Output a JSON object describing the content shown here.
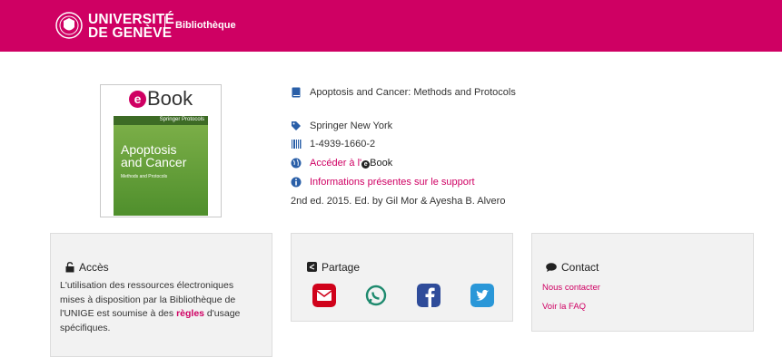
{
  "header": {
    "logo_line1": "UNIVERSITÉ",
    "logo_line2": "DE GENÈVE",
    "site_name": "Bibliothèque",
    "brand_color": "#cf0063"
  },
  "cover": {
    "logo_letter": "e",
    "logo_text": "Book",
    "book_title_line1": "Apoptosis",
    "book_title_line2": "and Cancer",
    "book_subtitle": "Methods and Protocols",
    "publisher_band": "Springer Protocols"
  },
  "details": {
    "title": "Apoptosis and Cancer: Methods and Protocols",
    "publisher": "Springer New York",
    "isbn": "1-4939-1660-2",
    "access_link_prefix": "Accéder à l'",
    "access_link_suffix": "Book",
    "support_info": "Informations présentes sur le support",
    "edition": "2nd ed. 2015. Ed. by Gil Mor & Ayesha B. Alvero"
  },
  "acces": {
    "title": "Accès",
    "text_before": "L'utilisation des ressources électroniques mises à disposition par la Bibliothèque de l'UNIGE est soumise à des ",
    "link": "règles",
    "text_after": " d'usage spécifiques."
  },
  "partage": {
    "title": "Partage",
    "buttons": [
      "email-icon",
      "whatsapp-icon",
      "facebook-icon",
      "twitter-icon"
    ]
  },
  "contact": {
    "title": "Contact",
    "links": [
      "Nous contacter",
      "Voir la FAQ"
    ]
  }
}
